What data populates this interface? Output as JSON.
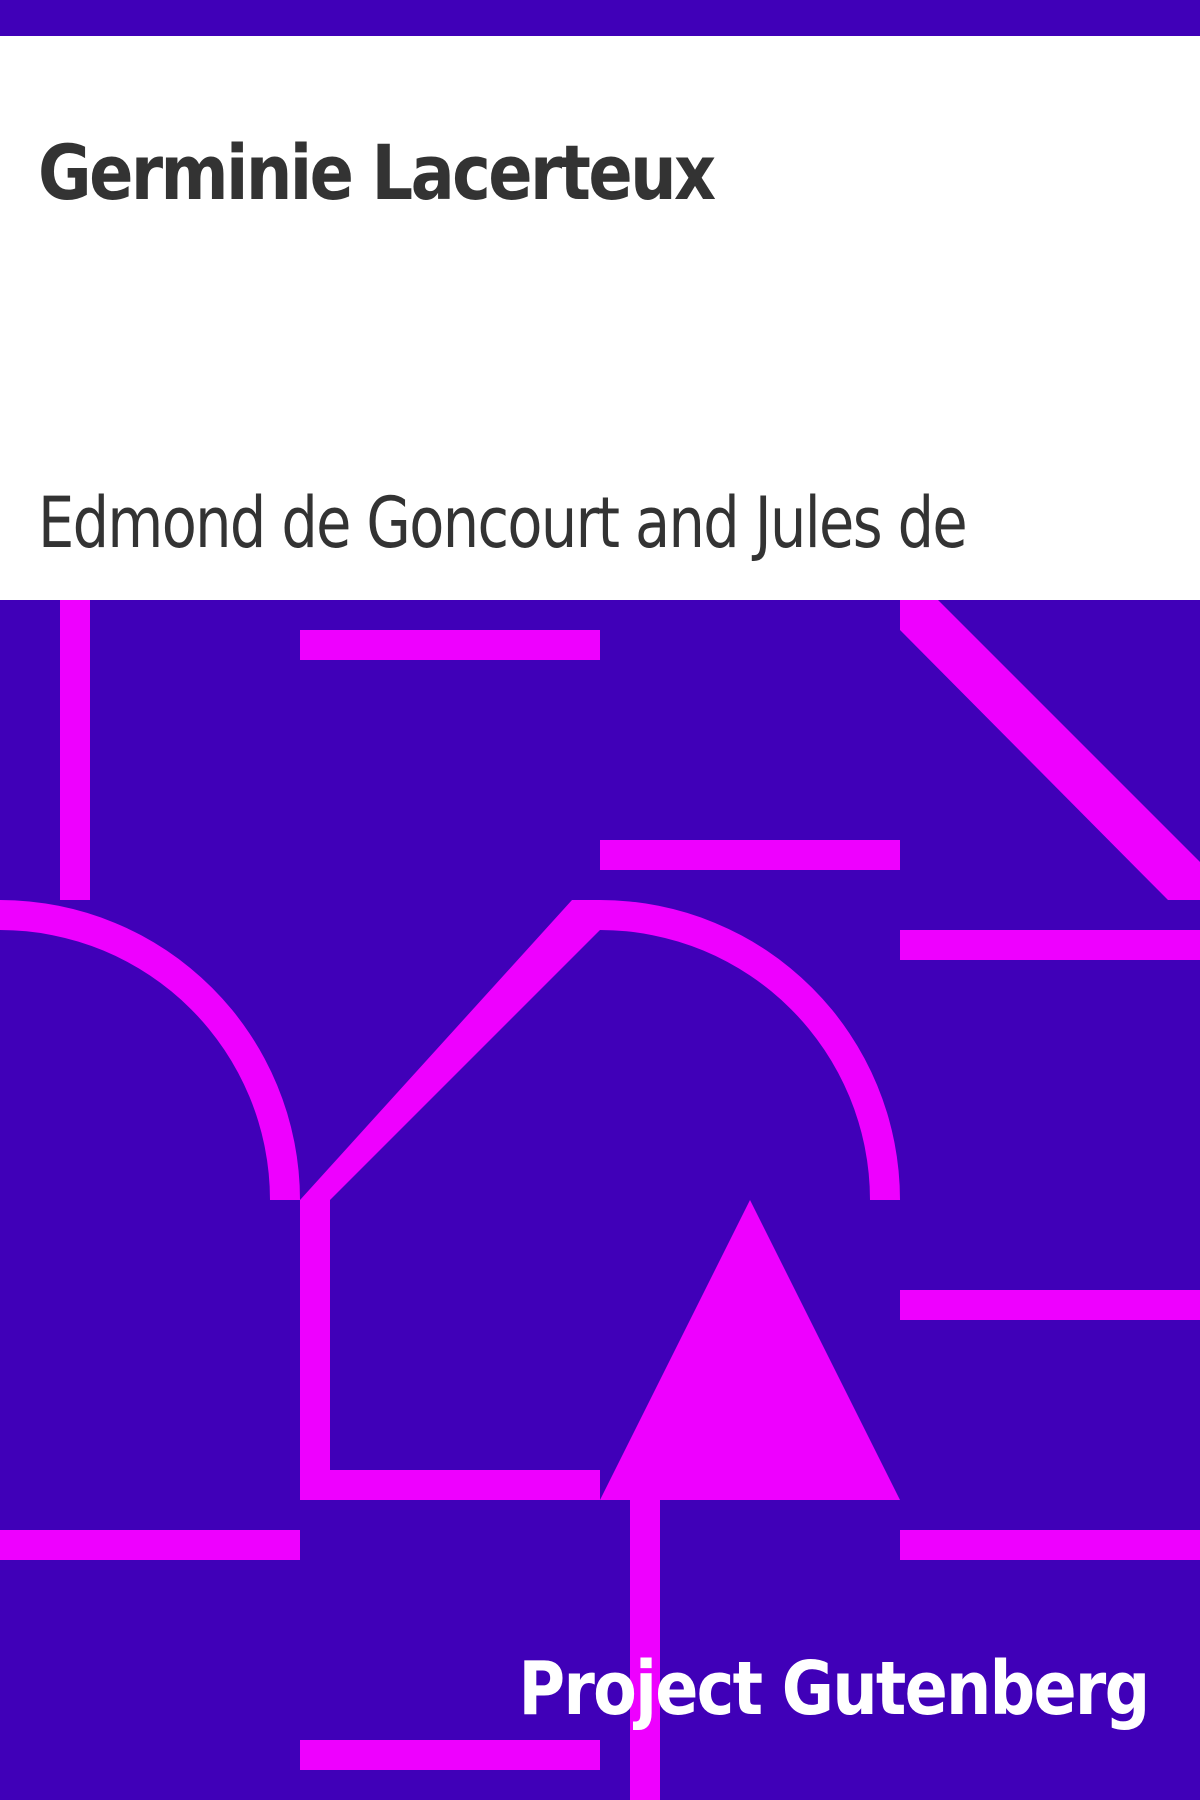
{
  "cover": {
    "title": "Germinie Lacerteux",
    "author": "Edmond de Goncourt and Jules de",
    "publisher": "Project Gutenberg"
  },
  "colors": {
    "background_art": "#4000b8",
    "accent": "#ee00ff",
    "header_background": "#ffffff",
    "text_dark": "#333333",
    "text_light": "#ffffff"
  },
  "art_shapes": [
    "vertical-bar",
    "horizontal-bar",
    "diagonal-bar",
    "quarter-arc",
    "triangle-arrow"
  ]
}
